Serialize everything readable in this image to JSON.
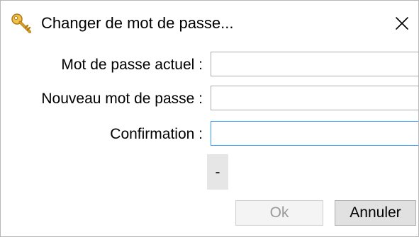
{
  "window": {
    "title": "Changer de mot de passe...",
    "title_icon": "key-icon",
    "close_icon": "close-icon",
    "close_glyph": "✕"
  },
  "form": {
    "current_password_label": "Mot de passe actuel :",
    "current_password_value": "",
    "new_password_label": "Nouveau mot de passe :",
    "new_password_value": "",
    "confirmation_label": "Confirmation :",
    "confirmation_value": "",
    "strength_indicator": "-"
  },
  "buttons": {
    "ok_label": "Ok",
    "cancel_label": "Annuler"
  },
  "colors": {
    "focus_border": "#3399ff",
    "input_border": "#abadb3",
    "disabled_text": "#9a9a9a",
    "key_gold": "#e0a020"
  }
}
